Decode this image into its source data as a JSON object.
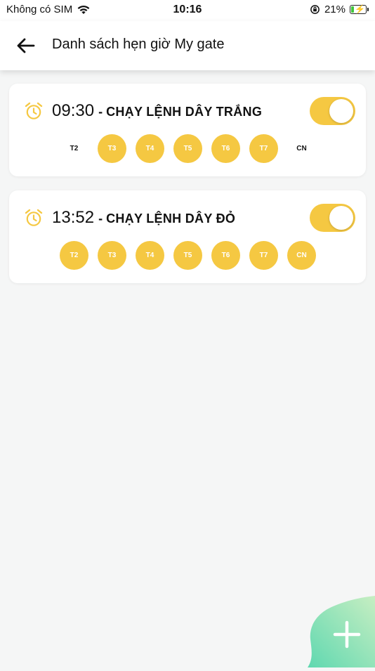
{
  "status_bar": {
    "carrier": "Không có SIM",
    "time": "10:16",
    "battery_percent": "21%",
    "battery_level": 0.21
  },
  "header": {
    "title": "Danh sách hẹn giờ My gate"
  },
  "colors": {
    "accent": "#f5c842",
    "fab_start": "#5fd8b0",
    "fab_end": "#c7eec2"
  },
  "timers": [
    {
      "time": "09:30",
      "separator": "-",
      "name": "CHẠY LỆNH DÂY TRẮNG",
      "enabled": true,
      "days": [
        {
          "label": "T2",
          "active": false
        },
        {
          "label": "T3",
          "active": true
        },
        {
          "label": "T4",
          "active": true
        },
        {
          "label": "T5",
          "active": true
        },
        {
          "label": "T6",
          "active": true
        },
        {
          "label": "T7",
          "active": true
        },
        {
          "label": "CN",
          "active": false
        }
      ]
    },
    {
      "time": "13:52",
      "separator": "-",
      "name": "CHẠY LỆNH DÂY ĐỎ",
      "enabled": true,
      "days": [
        {
          "label": "T2",
          "active": true
        },
        {
          "label": "T3",
          "active": true
        },
        {
          "label": "T4",
          "active": true
        },
        {
          "label": "T5",
          "active": true
        },
        {
          "label": "T6",
          "active": true
        },
        {
          "label": "T7",
          "active": true
        },
        {
          "label": "CN",
          "active": true
        }
      ]
    }
  ],
  "icons": {
    "back": "arrow-left-icon",
    "alarm": "alarm-clock-icon",
    "add": "plus-icon",
    "wifi": "wifi-icon",
    "orientation_lock": "orientation-lock-icon",
    "battery": "battery-charging-icon"
  }
}
